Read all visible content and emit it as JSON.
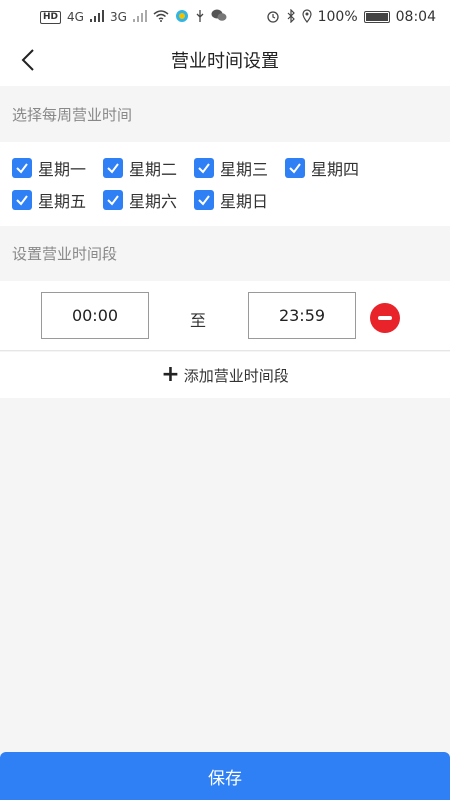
{
  "status_bar": {
    "hd": "HD",
    "net1": "4G",
    "net2": "3G",
    "battery_pct": "100%",
    "time": "08:04",
    "icons": [
      "signal-icon",
      "wifi-icon",
      "alarm-icon",
      "bluetooth-icon",
      "location-icon",
      "battery-icon"
    ]
  },
  "nav": {
    "title": "营业时间设置",
    "back_icon": "chevron-left-icon"
  },
  "days_section": {
    "label": "选择每周营业时间",
    "days": [
      {
        "label": "星期一",
        "checked": true
      },
      {
        "label": "星期二",
        "checked": true
      },
      {
        "label": "星期三",
        "checked": true
      },
      {
        "label": "星期四",
        "checked": true
      },
      {
        "label": "星期五",
        "checked": true
      },
      {
        "label": "星期六",
        "checked": true
      },
      {
        "label": "星期日",
        "checked": true
      }
    ]
  },
  "time_section": {
    "label": "设置营业时间段",
    "slots": [
      {
        "start": "00:00",
        "sep": "至",
        "end": "23:59"
      }
    ],
    "add_label": "添加营业时间段"
  },
  "footer": {
    "save_label": "保存"
  },
  "colors": {
    "accent": "#2f7ff5",
    "danger": "#e8232a"
  }
}
